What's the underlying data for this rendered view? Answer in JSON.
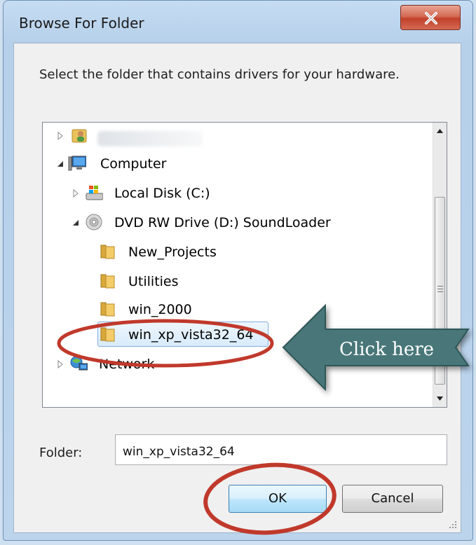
{
  "window": {
    "title": "Browse For Folder"
  },
  "instruction": "Select the folder that contains drivers for your hardware.",
  "tree": {
    "items": [
      {
        "label": "",
        "icon": "user-folder-icon",
        "expanded": false,
        "redacted": true
      },
      {
        "label": "Computer",
        "icon": "computer-icon",
        "expanded": true
      },
      {
        "label": "Local Disk (C:)",
        "icon": "local-disk-icon",
        "expanded": false
      },
      {
        "label": "DVD RW Drive (D:) SoundLoader",
        "icon": "dvd-drive-icon",
        "expanded": true
      },
      {
        "label": "New_Projects",
        "icon": "folder-icon"
      },
      {
        "label": "Utilities",
        "icon": "folder-icon"
      },
      {
        "label": "win_2000",
        "icon": "folder-icon"
      },
      {
        "label": "win_xp_vista32_64",
        "icon": "folder-icon",
        "selected": true
      },
      {
        "label": "Network",
        "icon": "network-icon",
        "expanded": false
      }
    ]
  },
  "folder": {
    "label": "Folder:",
    "value": "win_xp_vista32_64"
  },
  "buttons": {
    "ok": "OK",
    "cancel": "Cancel"
  },
  "annotation": {
    "callout_text": "Click here",
    "arrow_color": "#4a7779",
    "circle_color": "#c0392b"
  }
}
